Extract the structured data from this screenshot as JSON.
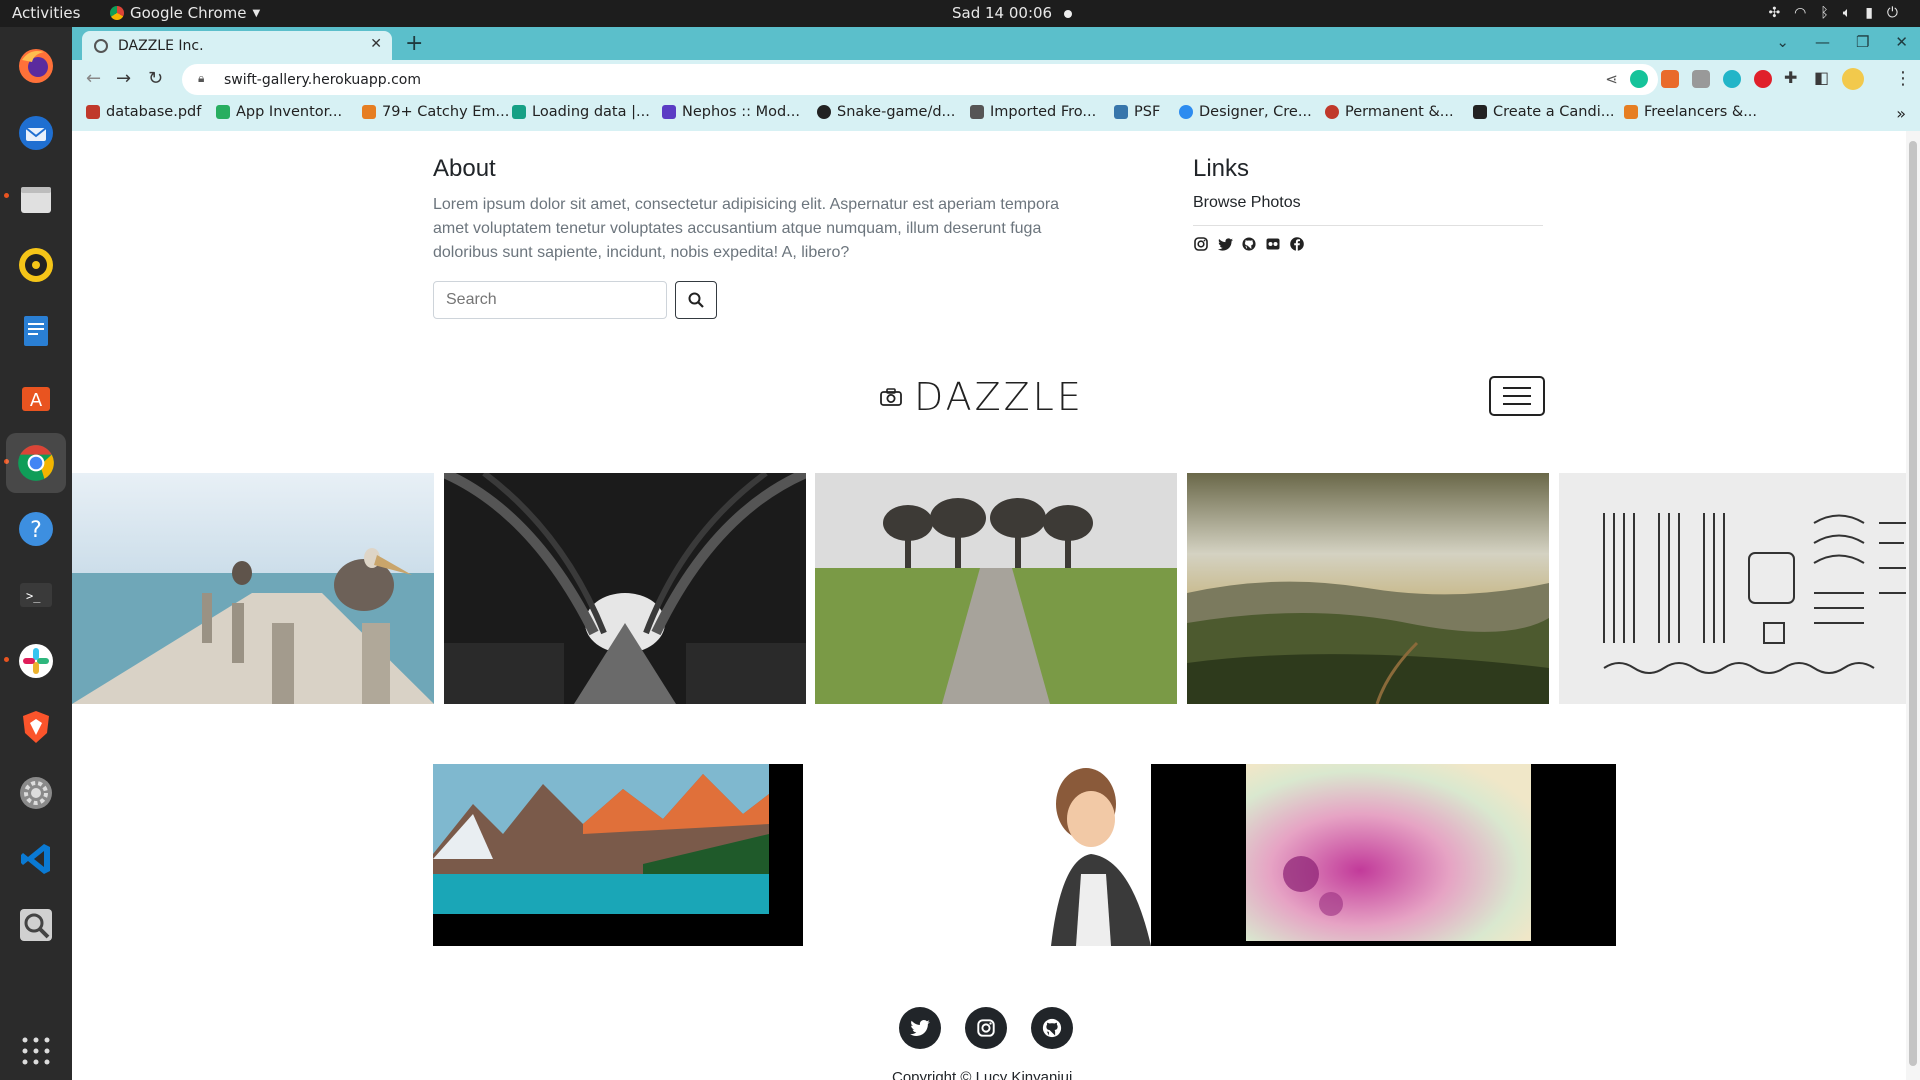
{
  "topbar": {
    "activities": "Activities",
    "app_name": "Google Chrome",
    "clock": "Sad 14  00:06"
  },
  "dock": {
    "items": [
      "firefox-icon",
      "thunderbird-icon",
      "files-icon",
      "rhythmbox-icon",
      "writer-icon",
      "software-icon",
      "chrome-icon",
      "help-icon",
      "terminal-icon",
      "slack-icon",
      "brave-icon",
      "settings-icon",
      "vscode-icon",
      "magnifier-icon",
      "apps-grid-icon"
    ]
  },
  "browser": {
    "tab_title": "DAZZLE Inc.",
    "url": "swift-gallery.herokuapp.com",
    "accent": "#5bbfcb",
    "bookmarks": [
      {
        "label": "database.pdf",
        "color": "#c0392b"
      },
      {
        "label": "App Inventor...",
        "color": "#27ae60"
      },
      {
        "label": "79+ Catchy Em...",
        "color": "#e67e22"
      },
      {
        "label": "Loading data |...",
        "color": "#16a085"
      },
      {
        "label": "Nephos :: Mod...",
        "color": "#5b3cc4"
      },
      {
        "label": "Snake-game/d...",
        "color": "#222222"
      },
      {
        "label": "Imported Fro...",
        "color": "#555555"
      },
      {
        "label": "PSF",
        "color": "#3776ab"
      },
      {
        "label": "Designer, Cre...",
        "color": "#2d8cf0"
      },
      {
        "label": "Permanent &...",
        "color": "#c0392b"
      },
      {
        "label": "Create a Candi...",
        "color": "#222222"
      },
      {
        "label": "Freelancers &...",
        "color": "#e67e22"
      }
    ]
  },
  "about": {
    "title": "About",
    "text": "Lorem ipsum dolor sit amet, consectetur adipisicing elit. Aspernatur est aperiam tempora amet voluptatem tenetur voluptates accusantium atque numquam, illum deserunt fuga doloribus sunt sapiente, incidunt, nobis expedita! A, libero?",
    "search_placeholder": "Search"
  },
  "links": {
    "title": "Links",
    "browse": "Browse Photos",
    "social": [
      "instagram-icon",
      "twitter-icon",
      "github-icon",
      "flickr-icon",
      "facebook-icon"
    ]
  },
  "brand": {
    "name": "DAZZLE"
  },
  "gallery": {
    "photos": [
      "pelican-pier",
      "tree-tunnel",
      "field-path",
      "hills-sunset",
      "typewriter-parts"
    ],
    "photos2": [
      "mountain-lake",
      "cartoon-woman-abstract-painting"
    ]
  },
  "footer": {
    "icons": [
      "twitter-icon",
      "instagram-icon",
      "github-icon"
    ],
    "copyright": "Copyright © Lucy Kinyanjui"
  }
}
